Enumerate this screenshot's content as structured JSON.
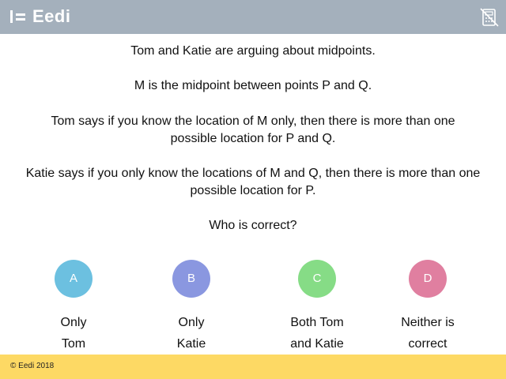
{
  "header": {
    "brand": "Eedi",
    "calculator_icon": "calculator-crossed-icon",
    "background": "#a4b0bc"
  },
  "question": {
    "lines": [
      "Tom and Katie are arguing about midpoints.",
      "M is the midpoint between points P and Q.",
      "Tom says if you know the location of M only, then there is more than one possible location for P and Q.",
      "Katie says if you only know the locations of M and Q, then there is more than one possible location for P.",
      "Who is correct?"
    ]
  },
  "options": [
    {
      "letter": "A",
      "line1": "Only",
      "line2": "Tom",
      "color": "#6cc0e0"
    },
    {
      "letter": "B",
      "line1": "Only",
      "line2": "Katie",
      "color": "#8a97e0"
    },
    {
      "letter": "C",
      "line1": "Both Tom",
      "line2": "and Katie",
      "color": "#86dc86"
    },
    {
      "letter": "D",
      "line1": "Neither is",
      "line2": "correct",
      "color": "#e07fa0"
    }
  ],
  "footer": {
    "copyright": "© Eedi 2018",
    "background": "#fdd964"
  }
}
